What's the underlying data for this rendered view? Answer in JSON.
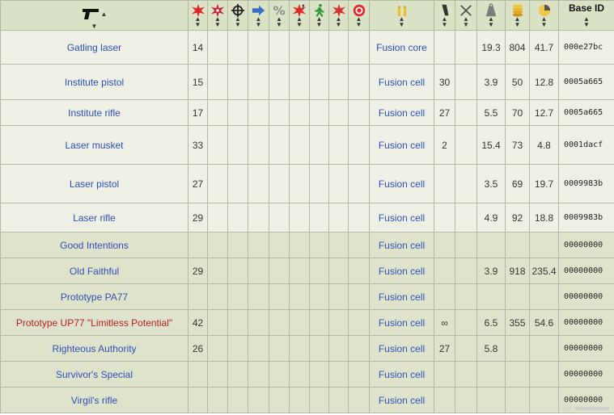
{
  "header": {
    "base_id_label": "Base ID",
    "icons": [
      "gun-icon",
      "damage-icon",
      "dps-icon",
      "accuracy-icon",
      "rate-of-fire-icon",
      "critical-chance-icon",
      "critical-damage-icon",
      "ap-cost-icon",
      "vats-damage-icon",
      "projectile-icon",
      "ammo-icon",
      "magazine-icon",
      "repair-icon",
      "weight-icon",
      "value-icon",
      "value-weight-icon"
    ]
  },
  "rows": [
    {
      "name": "Gatling laser",
      "damage": "14",
      "ammo": "Fusion core",
      "magazine": "",
      "weight": "19.3",
      "value": "804",
      "vw": "41.7",
      "base_id": "000e27bc",
      "red": false,
      "shade": "light",
      "h": 42
    },
    {
      "name": "Institute pistol",
      "damage": "15",
      "ammo": "Fusion cell",
      "magazine": "30",
      "weight": "3.9",
      "value": "50",
      "vw": "12.8",
      "base_id": "0005a665",
      "red": false,
      "shade": "light",
      "h": 44
    },
    {
      "name": "Institute rifle",
      "damage": "17",
      "ammo": "Fusion cell",
      "magazine": "27",
      "weight": "5.5",
      "value": "70",
      "vw": "12.7",
      "base_id": "0005a665",
      "red": false,
      "shade": "light",
      "h": 32
    },
    {
      "name": "Laser musket",
      "damage": "33",
      "ammo": "Fusion cell",
      "magazine": "2",
      "weight": "15.4",
      "value": "73",
      "vw": "4.8",
      "base_id": "0001dacf",
      "red": false,
      "shade": "light",
      "h": 48
    },
    {
      "name": "Laser pistol",
      "damage": "27",
      "ammo": "Fusion cell",
      "magazine": "",
      "weight": "3.5",
      "value": "69",
      "vw": "19.7",
      "base_id": "0009983b",
      "red": false,
      "shade": "light",
      "h": 48
    },
    {
      "name": "Laser rifle",
      "damage": "29",
      "ammo": "Fusion cell",
      "magazine": "",
      "weight": "4.9",
      "value": "92",
      "vw": "18.8",
      "base_id": "0009983b",
      "red": false,
      "shade": "light",
      "h": 36
    },
    {
      "name": "Good Intentions",
      "damage": "",
      "ammo": "Fusion cell",
      "magazine": "",
      "weight": "",
      "value": "",
      "vw": "",
      "base_id": "00000000",
      "red": false,
      "shade": "dark",
      "h": 32
    },
    {
      "name": "Old Faithful",
      "damage": "29",
      "ammo": "Fusion cell",
      "magazine": "",
      "weight": "3.9",
      "value": "918",
      "vw": "235.4",
      "base_id": "00000000",
      "red": false,
      "shade": "dark",
      "h": 32
    },
    {
      "name": "Prototype PA77",
      "damage": "",
      "ammo": "Fusion cell",
      "magazine": "",
      "weight": "",
      "value": "",
      "vw": "",
      "base_id": "00000000",
      "red": false,
      "shade": "dark",
      "h": 32
    },
    {
      "name": "Prototype UP77 \"Limitless Potential\"",
      "damage": "42",
      "ammo": "Fusion cell",
      "magazine": "∞",
      "weight": "6.5",
      "value": "355",
      "vw": "54.6",
      "base_id": "00000000",
      "red": true,
      "shade": "dark",
      "h": 32
    },
    {
      "name": "Righteous Authority",
      "damage": "26",
      "ammo": "Fusion cell",
      "magazine": "27",
      "weight": "5.8",
      "value": "",
      "vw": "",
      "base_id": "00000000",
      "red": false,
      "shade": "dark",
      "h": 32
    },
    {
      "name": "Survivor's Special",
      "damage": "",
      "ammo": "Fusion cell",
      "magazine": "",
      "weight": "",
      "value": "",
      "vw": "",
      "base_id": "00000000",
      "red": false,
      "shade": "dark",
      "h": 32
    },
    {
      "name": "Virgil's rifle",
      "damage": "",
      "ammo": "Fusion cell",
      "magazine": "",
      "weight": "",
      "value": "",
      "vw": "",
      "base_id": "00000000",
      "red": false,
      "shade": "dark",
      "h": 32
    }
  ]
}
